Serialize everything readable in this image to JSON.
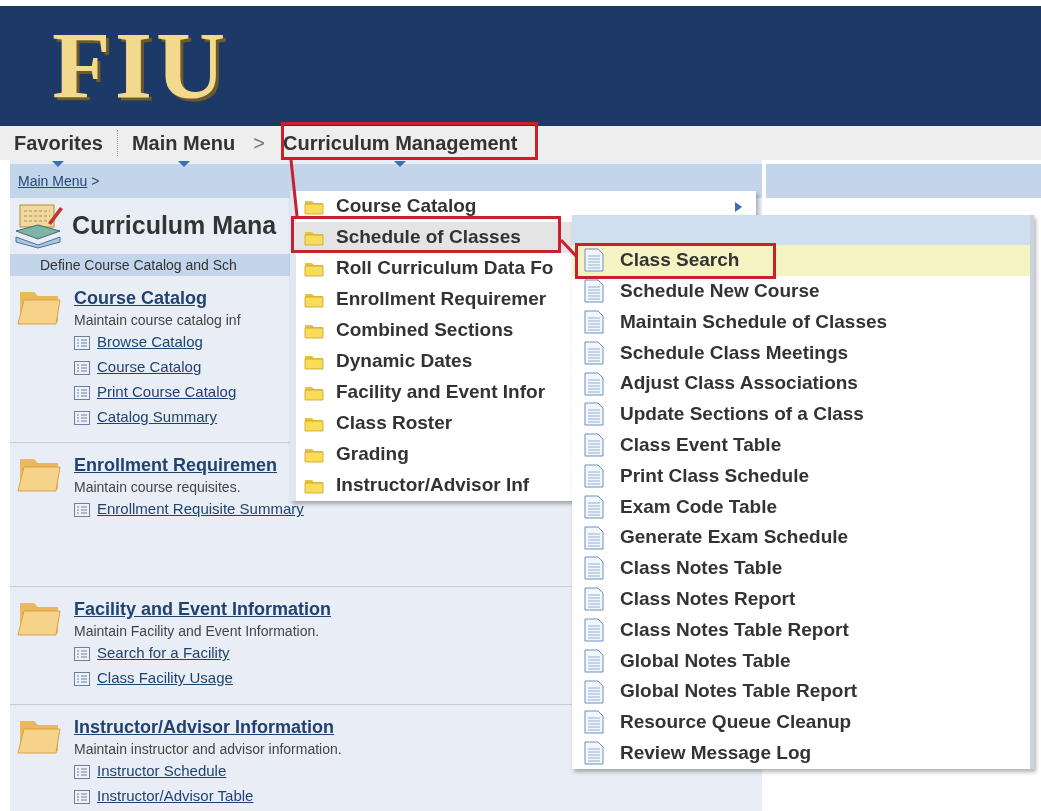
{
  "header": {
    "logo": "FIU"
  },
  "nav": {
    "items": [
      {
        "label": "Favorites"
      },
      {
        "label": "Main Menu"
      },
      {
        "label": "Curriculum Management"
      }
    ],
    "separator": ">"
  },
  "breadcrumb": {
    "link": "Main Menu",
    "separator": ">"
  },
  "page": {
    "title": "Curriculum Mana",
    "description": "Define Course Catalog and Sch"
  },
  "sections": [
    {
      "title": "Course Catalog",
      "description": "Maintain course catalog inf",
      "links": [
        "Browse Catalog",
        "Course Catalog",
        "Print Course Catalog",
        "Catalog Summary"
      ]
    },
    {
      "title": "Enrollment Requiremen",
      "description": "Maintain course requisites.",
      "links": [
        "Enrollment Requisite Summary"
      ]
    },
    {
      "title": "Facility and Event Information",
      "description": "Maintain Facility and Event Information.",
      "links": [
        "Search for a Facility",
        "Class Facility Usage"
      ]
    },
    {
      "title": "Instructor/Advisor Information",
      "description": "Maintain instructor and advisor information.",
      "links": [
        "Instructor Schedule",
        "Instructor/Advisor Table"
      ]
    }
  ],
  "menu": {
    "items": [
      {
        "label": "Course Catalog",
        "selected": false,
        "has_submenu": true
      },
      {
        "label": "Schedule of Classes",
        "selected": true,
        "has_submenu": false
      },
      {
        "label": "Roll Curriculum Data Fo",
        "selected": false,
        "has_submenu": false
      },
      {
        "label": "Enrollment Requiremer",
        "selected": false,
        "has_submenu": false
      },
      {
        "label": "Combined Sections",
        "selected": false,
        "has_submenu": false
      },
      {
        "label": "Dynamic Dates",
        "selected": false,
        "has_submenu": false
      },
      {
        "label": "Facility and Event Infor",
        "selected": false,
        "has_submenu": false
      },
      {
        "label": "Class Roster",
        "selected": false,
        "has_submenu": false
      },
      {
        "label": "Grading",
        "selected": false,
        "has_submenu": false
      },
      {
        "label": "Instructor/Advisor Inf",
        "selected": false,
        "has_submenu": false
      }
    ]
  },
  "submenu": {
    "items": [
      {
        "label": "Class Search",
        "selected": true
      },
      {
        "label": "Schedule New Course",
        "selected": false
      },
      {
        "label": "Maintain Schedule of Classes",
        "selected": false
      },
      {
        "label": "Schedule Class Meetings",
        "selected": false
      },
      {
        "label": "Adjust Class Associations",
        "selected": false
      },
      {
        "label": "Update Sections of a Class",
        "selected": false
      },
      {
        "label": "Class Event Table",
        "selected": false
      },
      {
        "label": "Print Class Schedule",
        "selected": false
      },
      {
        "label": "Exam Code Table",
        "selected": false
      },
      {
        "label": "Generate Exam Schedule",
        "selected": false
      },
      {
        "label": "Class Notes Table",
        "selected": false
      },
      {
        "label": "Class Notes Report",
        "selected": false
      },
      {
        "label": "Class Notes Table Report",
        "selected": false
      },
      {
        "label": "Global Notes Table",
        "selected": false
      },
      {
        "label": "Global Notes Table Report",
        "selected": false
      },
      {
        "label": "Resource Queue Cleanup",
        "selected": false
      },
      {
        "label": "Review Message Log",
        "selected": false
      }
    ]
  }
}
